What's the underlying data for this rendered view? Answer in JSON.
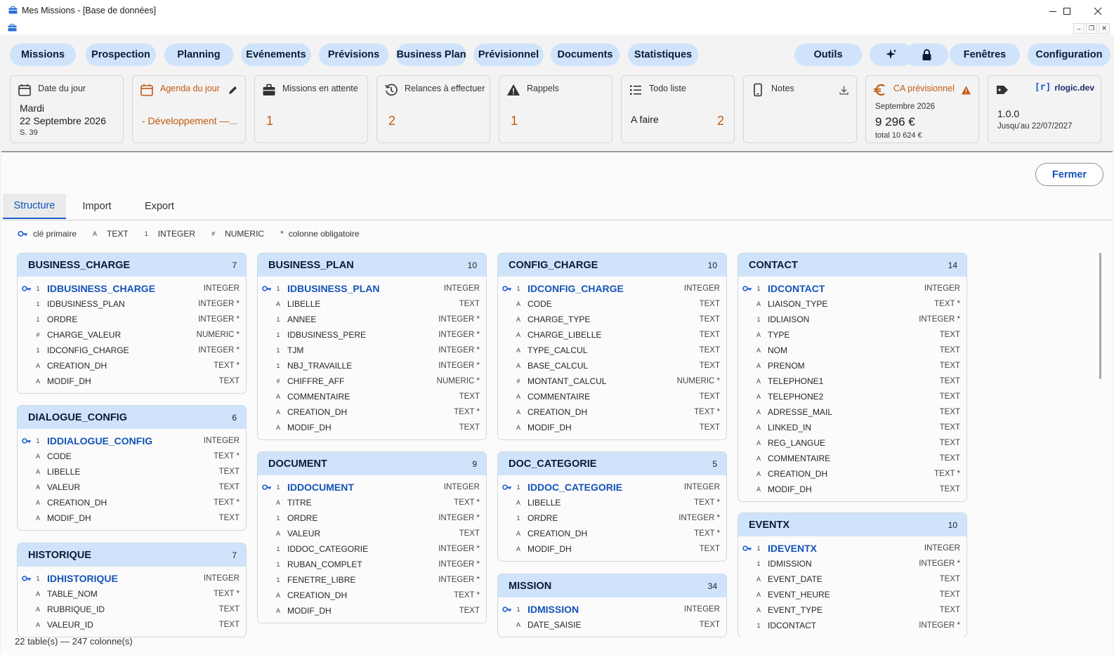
{
  "window": {
    "title": "Mes Missions - [Base de données]"
  },
  "toolbar": {
    "left": [
      "Missions",
      "Prospection",
      "Planning",
      "Evénements",
      "Prévisions",
      "Business Plan",
      "Prévisionnel",
      "Documents",
      "Statistiques"
    ],
    "right": {
      "outils": "Outils",
      "fenetres": "Fenêtres",
      "configuration": "Configuration"
    }
  },
  "widgets": {
    "date": {
      "title": "Date du jour",
      "day": "Mardi",
      "date": "22 Septembre 2026",
      "week": "S. 39"
    },
    "agenda": {
      "title": "Agenda du jour",
      "item": "- Développement —..."
    },
    "missions": {
      "title": "Missions en attente",
      "count": "1"
    },
    "relances": {
      "title": "Relances à effectuer",
      "count": "2"
    },
    "rappels": {
      "title": "Rappels",
      "count": "1"
    },
    "todo": {
      "title": "Todo liste",
      "label": "A faire",
      "count": "2"
    },
    "notes": {
      "title": "Notes"
    },
    "ca": {
      "title": "CA prévisionnel",
      "month": "Septembre 2026",
      "amount": "9 296 €",
      "total": "total 10 624 €"
    },
    "version": {
      "brand": "rlogic.dev",
      "version": "1.0.0",
      "until": "Jusqu'au 22/07/2027"
    }
  },
  "fermer": "Fermer",
  "tabs": [
    "Structure",
    "Import",
    "Export"
  ],
  "legend": {
    "pk": "clé primaire",
    "text": {
      "sym": "A",
      "label": "TEXT"
    },
    "integer": {
      "sym": "1",
      "label": "INTEGER"
    },
    "numeric": {
      "sym": "#",
      "label": "NUMERIC"
    },
    "required": {
      "sym": "*",
      "label": "colonne obligatoire"
    }
  },
  "tables": [
    {
      "name": "BUSINESS_CHARGE",
      "count": "7",
      "cols": [
        [
          "1",
          "IDBUSINESS_CHARGE",
          "INTEGER"
        ],
        [
          "1",
          "IDBUSINESS_PLAN",
          "INTEGER *"
        ],
        [
          "1",
          "ORDRE",
          "INTEGER *"
        ],
        [
          "#",
          "CHARGE_VALEUR",
          "NUMERIC *"
        ],
        [
          "1",
          "IDCONFIG_CHARGE",
          "INTEGER *"
        ],
        [
          "A",
          "CREATION_DH",
          "TEXT *"
        ],
        [
          "A",
          "MODIF_DH",
          "TEXT"
        ]
      ]
    },
    {
      "name": "DIALOGUE_CONFIG",
      "count": "6",
      "cols": [
        [
          "1",
          "IDDIALOGUE_CONFIG",
          "INTEGER"
        ],
        [
          "A",
          "CODE",
          "TEXT *"
        ],
        [
          "A",
          "LIBELLE",
          "TEXT"
        ],
        [
          "A",
          "VALEUR",
          "TEXT"
        ],
        [
          "A",
          "CREATION_DH",
          "TEXT *"
        ],
        [
          "A",
          "MODIF_DH",
          "TEXT"
        ]
      ]
    },
    {
      "name": "HISTORIQUE",
      "count": "7",
      "cols": [
        [
          "1",
          "IDHISTORIQUE",
          "INTEGER"
        ],
        [
          "A",
          "TABLE_NOM",
          "TEXT *"
        ],
        [
          "A",
          "RUBRIQUE_ID",
          "TEXT"
        ],
        [
          "A",
          "VALEUR_ID",
          "TEXT"
        ]
      ]
    },
    {
      "name": "BUSINESS_PLAN",
      "count": "10",
      "cols": [
        [
          "1",
          "IDBUSINESS_PLAN",
          "INTEGER"
        ],
        [
          "A",
          "LIBELLE",
          "TEXT"
        ],
        [
          "1",
          "ANNEE",
          "INTEGER *"
        ],
        [
          "1",
          "IDBUSINESS_PERE",
          "INTEGER *"
        ],
        [
          "1",
          "TJM",
          "INTEGER *"
        ],
        [
          "1",
          "NBJ_TRAVAILLE",
          "INTEGER *"
        ],
        [
          "#",
          "CHIFFRE_AFF",
          "NUMERIC *"
        ],
        [
          "A",
          "COMMENTAIRE",
          "TEXT"
        ],
        [
          "A",
          "CREATION_DH",
          "TEXT *"
        ],
        [
          "A",
          "MODIF_DH",
          "TEXT"
        ]
      ]
    },
    {
      "name": "DOCUMENT",
      "count": "9",
      "cols": [
        [
          "1",
          "IDDOCUMENT",
          "INTEGER"
        ],
        [
          "A",
          "TITRE",
          "TEXT *"
        ],
        [
          "1",
          "ORDRE",
          "INTEGER *"
        ],
        [
          "A",
          "VALEUR",
          "TEXT"
        ],
        [
          "1",
          "IDDOC_CATEGORIE",
          "INTEGER *"
        ],
        [
          "1",
          "RUBAN_COMPLET",
          "INTEGER *"
        ],
        [
          "1",
          "FENETRE_LIBRE",
          "INTEGER *"
        ],
        [
          "A",
          "CREATION_DH",
          "TEXT *"
        ],
        [
          "A",
          "MODIF_DH",
          "TEXT"
        ]
      ]
    },
    {
      "name": "CONFIG_CHARGE",
      "count": "10",
      "cols": [
        [
          "1",
          "IDCONFIG_CHARGE",
          "INTEGER"
        ],
        [
          "A",
          "CODE",
          "TEXT"
        ],
        [
          "A",
          "CHARGE_TYPE",
          "TEXT"
        ],
        [
          "A",
          "CHARGE_LIBELLE",
          "TEXT"
        ],
        [
          "A",
          "TYPE_CALCUL",
          "TEXT"
        ],
        [
          "A",
          "BASE_CALCUL",
          "TEXT"
        ],
        [
          "#",
          "MONTANT_CALCUL",
          "NUMERIC *"
        ],
        [
          "A",
          "COMMENTAIRE",
          "TEXT"
        ],
        [
          "A",
          "CREATION_DH",
          "TEXT *"
        ],
        [
          "A",
          "MODIF_DH",
          "TEXT"
        ]
      ]
    },
    {
      "name": "DOC_CATEGORIE",
      "count": "5",
      "cols": [
        [
          "1",
          "IDDOC_CATEGORIE",
          "INTEGER"
        ],
        [
          "A",
          "LIBELLE",
          "TEXT *"
        ],
        [
          "1",
          "ORDRE",
          "INTEGER *"
        ],
        [
          "A",
          "CREATION_DH",
          "TEXT *"
        ],
        [
          "A",
          "MODIF_DH",
          "TEXT"
        ]
      ]
    },
    {
      "name": "MISSION",
      "count": "34",
      "cols": [
        [
          "1",
          "IDMISSION",
          "INTEGER"
        ],
        [
          "A",
          "DATE_SAISIE",
          "TEXT"
        ]
      ]
    },
    {
      "name": "CONTACT",
      "count": "14",
      "cols": [
        [
          "1",
          "IDCONTACT",
          "INTEGER"
        ],
        [
          "A",
          "LIAISON_TYPE",
          "TEXT *"
        ],
        [
          "1",
          "IDLIAISON",
          "INTEGER *"
        ],
        [
          "A",
          "TYPE",
          "TEXT"
        ],
        [
          "A",
          "NOM",
          "TEXT"
        ],
        [
          "A",
          "PRENOM",
          "TEXT"
        ],
        [
          "A",
          "TELEPHONE1",
          "TEXT"
        ],
        [
          "A",
          "TELEPHONE2",
          "TEXT"
        ],
        [
          "A",
          "ADRESSE_MAIL",
          "TEXT"
        ],
        [
          "A",
          "LINKED_IN",
          "TEXT"
        ],
        [
          "A",
          "REG_LANGUE",
          "TEXT"
        ],
        [
          "A",
          "COMMENTAIRE",
          "TEXT"
        ],
        [
          "A",
          "CREATION_DH",
          "TEXT *"
        ],
        [
          "A",
          "MODIF_DH",
          "TEXT"
        ]
      ]
    },
    {
      "name": "EVENTX",
      "count": "10",
      "cols": [
        [
          "1",
          "IDEVENTX",
          "INTEGER"
        ],
        [
          "1",
          "IDMISSION",
          "INTEGER *"
        ],
        [
          "A",
          "EVENT_DATE",
          "TEXT"
        ],
        [
          "A",
          "EVENT_HEURE",
          "TEXT"
        ],
        [
          "A",
          "EVENT_TYPE",
          "TEXT"
        ],
        [
          "1",
          "IDCONTACT",
          "INTEGER *"
        ]
      ]
    }
  ],
  "status": "22 table(s) — 247 colonne(s)"
}
